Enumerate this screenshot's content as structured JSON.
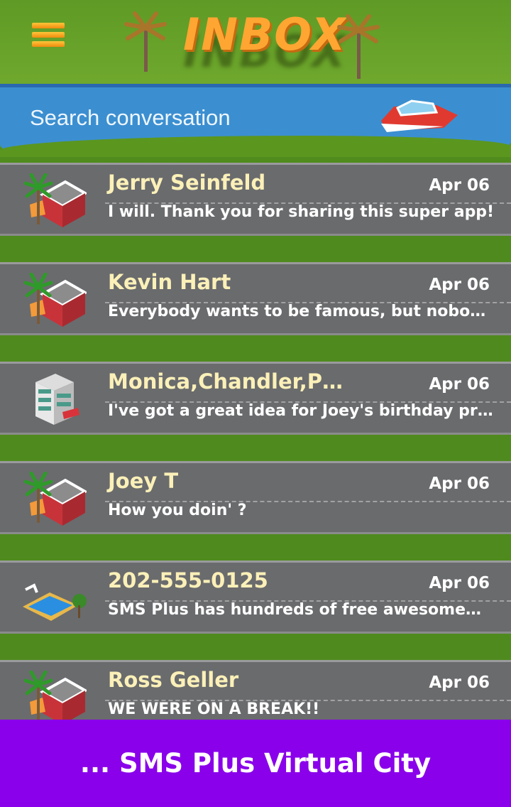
{
  "header": {
    "title": "INBOX",
    "search_placeholder": "Search conversation",
    "menu_icon": "hamburger-menu-icon"
  },
  "colors": {
    "banner": "#8a00ea",
    "name": "#fbf0b8",
    "title": "#ffa632",
    "river": "#3b8fd0"
  },
  "conversations": [
    {
      "name": "Jerry Seinfeld",
      "date": "Apr 06",
      "message": "I will. Thank you for sharing this super app!",
      "icon": "shop-building-icon"
    },
    {
      "name": "Kevin Hart",
      "date": "Apr 06",
      "message": "Everybody wants to be famous, but nobo…",
      "icon": "shop-building-icon"
    },
    {
      "name": "Monica,Chandler,P…",
      "date": "Apr 06",
      "message": "I've got a great idea for Joey's birthday pr…",
      "icon": "office-building-icon"
    },
    {
      "name": "Joey T",
      "date": "Apr 06",
      "message": "How you doin' ?",
      "icon": "shop-building-icon"
    },
    {
      "name": "202-555-0125",
      "date": "Apr 06",
      "message": "SMS Plus has hundreds of free awesome…",
      "icon": "swimming-pool-icon"
    },
    {
      "name": "Ross Geller",
      "date": "Apr 06",
      "message": "WE WERE ON  A BREAK!!",
      "icon": "shop-building-icon"
    }
  ],
  "banner": {
    "text": "... SMS Plus Virtual City"
  }
}
